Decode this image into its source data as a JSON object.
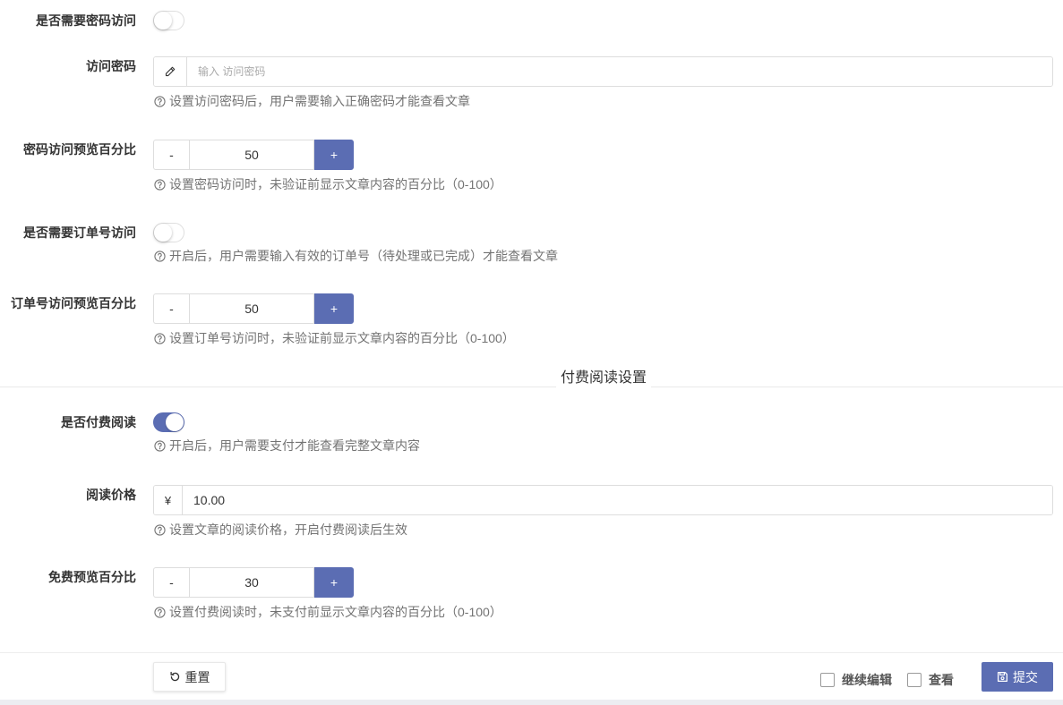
{
  "colors": {
    "primary": "#5b6db3",
    "help_text": "#737373"
  },
  "icons": {
    "help": "question-circle-icon",
    "password_addon": "pencil-icon",
    "reset": "refresh-icon",
    "submit": "save-icon"
  },
  "form": {
    "password_required": {
      "label": "是否需要密码访问",
      "checked": false
    },
    "access_password": {
      "label": "访问密码",
      "placeholder": "输入 访问密码",
      "help": "设置访问密码后，用户需要输入正确密码才能查看文章"
    },
    "password_preview_percent": {
      "label": "密码访问预览百分比",
      "decrement": "-",
      "increment": "+",
      "value": "50",
      "help": "设置密码访问时，未验证前显示文章内容的百分比（0-100）"
    },
    "order_required": {
      "label": "是否需要订单号访问",
      "checked": false,
      "help": "开启后，用户需要输入有效的订单号（待处理或已完成）才能查看文章"
    },
    "order_preview_percent": {
      "label": "订单号访问预览百分比",
      "decrement": "-",
      "increment": "+",
      "value": "50",
      "help": "设置订单号访问时，未验证前显示文章内容的百分比（0-100）"
    }
  },
  "paid_section": {
    "title": "付费阅读设置",
    "paid_reading": {
      "label": "是否付费阅读",
      "checked": true,
      "help": "开启后，用户需要支付才能查看完整文章内容"
    },
    "read_price": {
      "label": "阅读价格",
      "prefix": "¥",
      "value": "10.00",
      "help": "设置文章的阅读价格，开启付费阅读后生效"
    },
    "free_preview_percent": {
      "label": "免费预览百分比",
      "decrement": "-",
      "increment": "+",
      "value": "30",
      "help": "设置付费阅读时，未支付前显示文章内容的百分比（0-100）"
    }
  },
  "footer": {
    "reset_label": "重置",
    "continue_edit": {
      "label": "继续编辑",
      "checked": false
    },
    "view": {
      "label": "查看",
      "checked": false
    },
    "submit_label": "提交"
  }
}
